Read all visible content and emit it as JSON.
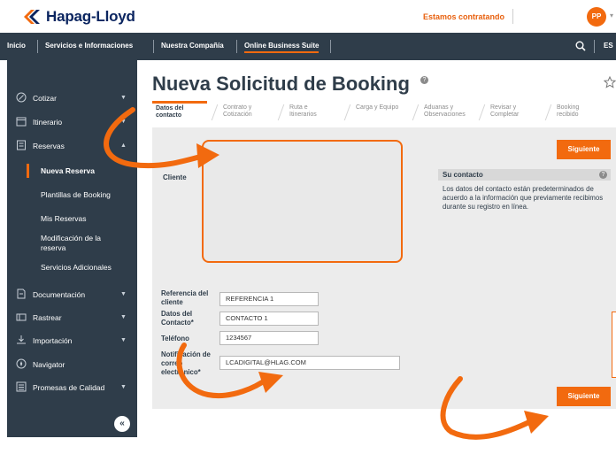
{
  "header": {
    "brand": "Hapag-Lloyd",
    "hiring_link": "Estamos contratando",
    "avatar_initials": "PP"
  },
  "nav": {
    "items": [
      "Inicio",
      "Servicios e Informaciones",
      "Nuestra Compañía",
      "Online Business Suite"
    ],
    "active": "Online Business Suite",
    "language": "ES"
  },
  "sidebar": {
    "cotizar": "Cotizar",
    "itinerario": "Itinerario",
    "reservas": "Reservas",
    "reservas_sub": [
      "Nueva Reserva",
      "Plantillas de Booking",
      "Mis Reservas",
      "Modificación de la reserva",
      "Servicios Adicionales"
    ],
    "documentacion": "Documentación",
    "rastrear": "Rastrear",
    "importacion": "Importación",
    "navigator": "Navigator",
    "promesas": "Promesas de Calidad",
    "collapse_glyph": "«"
  },
  "page": {
    "title": "Nueva Solicitud de Booking",
    "help_glyph": "?"
  },
  "steps": [
    [
      "Datos del",
      "contacto"
    ],
    [
      "Contrato y",
      "Cotización"
    ],
    [
      "Ruta e",
      "Itinerarios"
    ],
    [
      "Carga y Equipo",
      ""
    ],
    [
      "Aduanas y",
      "Observaciones"
    ],
    [
      "Revisar y",
      "Completar"
    ],
    [
      "Booking",
      "recibido"
    ]
  ],
  "form": {
    "next_button": "Siguiente",
    "cliente_label": "Cliente",
    "fields": [
      {
        "label": [
          "Referencia del",
          "cliente"
        ],
        "value": "REFERENCIA 1"
      },
      {
        "label": [
          "Datos del",
          "Contacto*"
        ],
        "value": "CONTACTO 1"
      },
      {
        "label": [
          "Teléfono",
          ""
        ],
        "value": "1234567"
      },
      {
        "label": [
          "Notificación de",
          "correo",
          "electrónico*"
        ],
        "value": "LCADIGITAL@HLAG.COM"
      }
    ]
  },
  "contact_box": {
    "title": "Su contacto",
    "text": "Los datos del contacto están predeterminados de acuerdo a la información que previamente recibimos durante su registro en línea."
  },
  "colors": {
    "accent": "#f26a0f",
    "navy": "#2f3d4a",
    "brand_blue": "#0b2560"
  }
}
